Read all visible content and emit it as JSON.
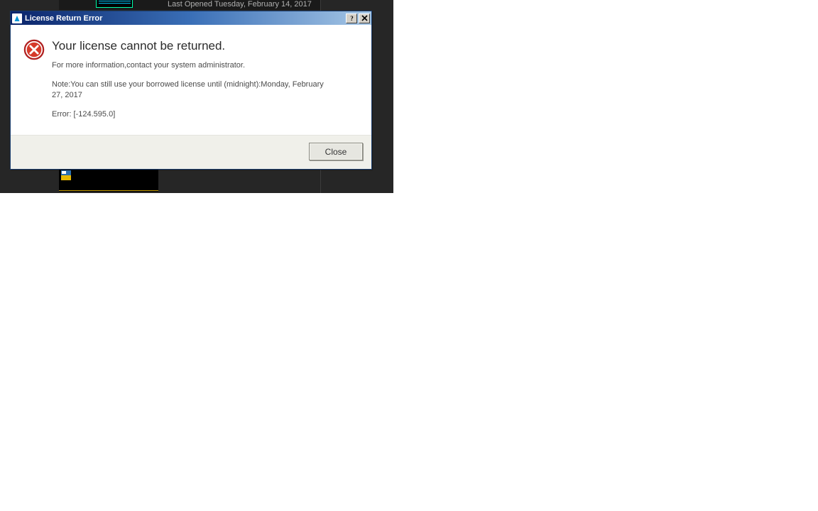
{
  "background": {
    "top_line": "Last Opened Tuesday, February 14, 2017"
  },
  "dialog": {
    "title": "License Return Error",
    "heading": "Your license cannot be returned.",
    "info_line": "For more information,contact your system administrator.",
    "note_line": "Note:You can still use your borrowed license until (midnight):Monday, February 27, 2017",
    "error_line": "Error: [-124.595.0]",
    "close_label": "Close"
  }
}
